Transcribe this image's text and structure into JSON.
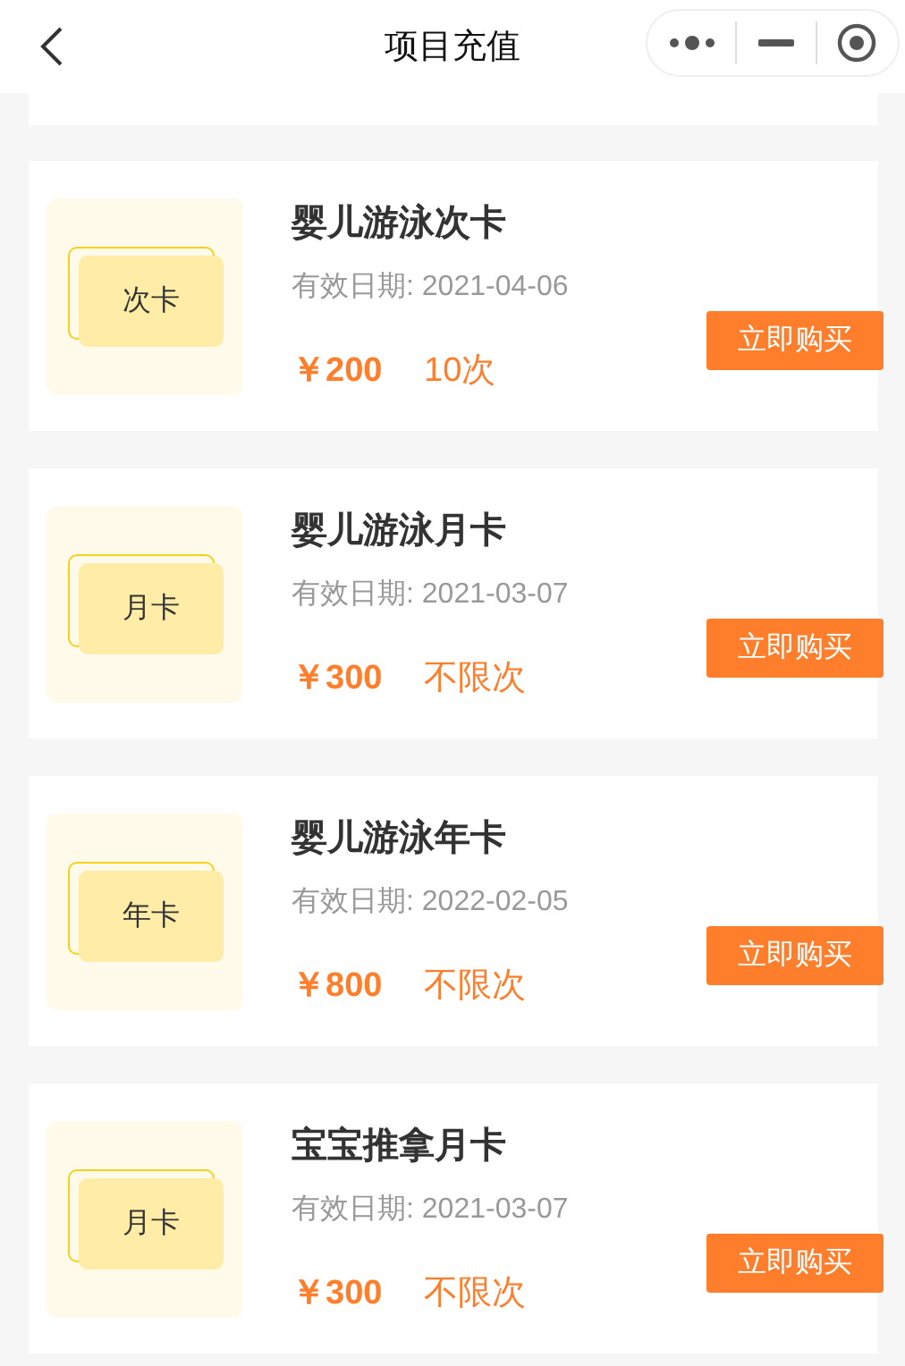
{
  "header": {
    "title": "项目充值"
  },
  "cards": [
    {
      "badge": "次卡",
      "name": "婴儿游泳次卡",
      "validity": "有效日期: 2021-04-06",
      "price": "￥200",
      "uses": "10次",
      "button": "立即购买"
    },
    {
      "badge": "月卡",
      "name": "婴儿游泳月卡",
      "validity": "有效日期: 2021-03-07",
      "price": "￥300",
      "uses": "不限次",
      "button": "立即购买"
    },
    {
      "badge": "年卡",
      "name": "婴儿游泳年卡",
      "validity": "有效日期: 2022-02-05",
      "price": "￥800",
      "uses": "不限次",
      "button": "立即购买"
    },
    {
      "badge": "月卡",
      "name": "宝宝推拿月卡",
      "validity": "有效日期: 2021-03-07",
      "price": "￥300",
      "uses": "不限次",
      "button": "立即购买"
    }
  ]
}
